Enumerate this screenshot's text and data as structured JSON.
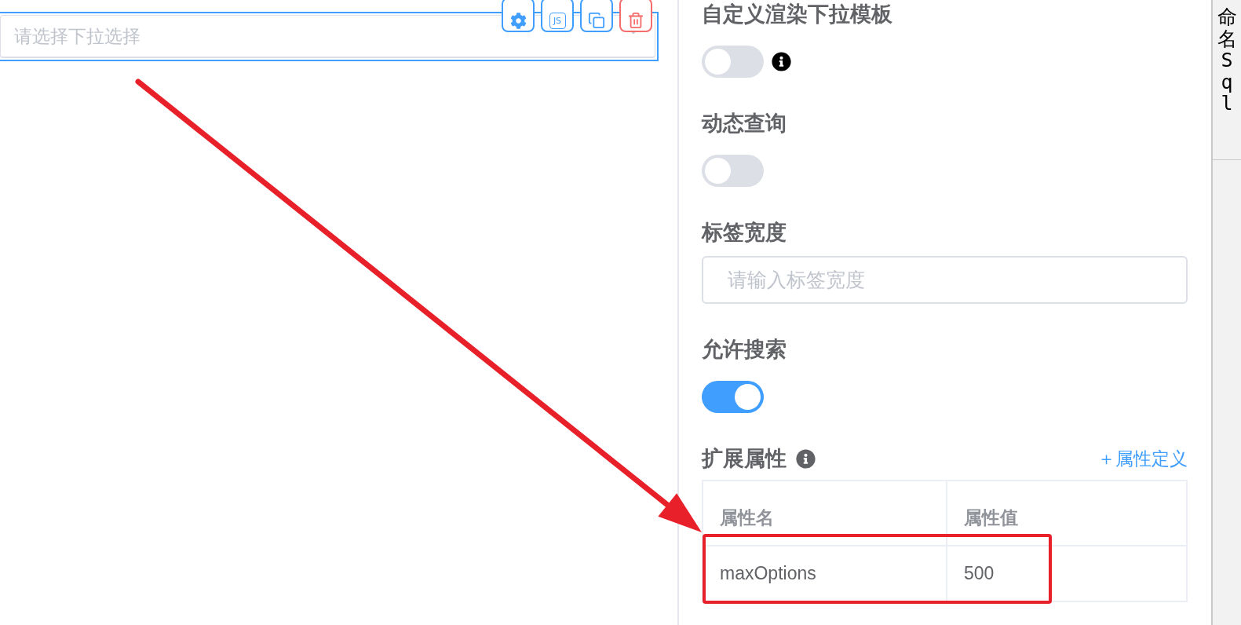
{
  "canvas": {
    "component": {
      "placeholder": "请选择下拉选择",
      "selected": true,
      "toolbar": [
        {
          "kind": "settings"
        },
        {
          "kind": "script",
          "label": "JS"
        },
        {
          "kind": "copy"
        },
        {
          "kind": "delete"
        }
      ]
    }
  },
  "properties": {
    "fields": [
      {
        "kind": "switch",
        "label": "自定义渲染下拉模板",
        "on": false,
        "info": true
      },
      {
        "kind": "switch",
        "label": "动态查询",
        "on": false,
        "info": false
      },
      {
        "kind": "input",
        "label": "标签宽度",
        "placeholder": "请输入标签宽度",
        "info": false
      },
      {
        "kind": "switch",
        "label": "允许搜索",
        "on": true,
        "info": false
      }
    ],
    "extended": {
      "label": "扩展属性",
      "info": true,
      "add_link": "＋属性定义",
      "columns": [
        "属性名",
        "属性值"
      ],
      "rows": [
        [
          "maxOptions",
          "500"
        ]
      ]
    }
  },
  "side_tab": {
    "label": "命名Sql"
  }
}
